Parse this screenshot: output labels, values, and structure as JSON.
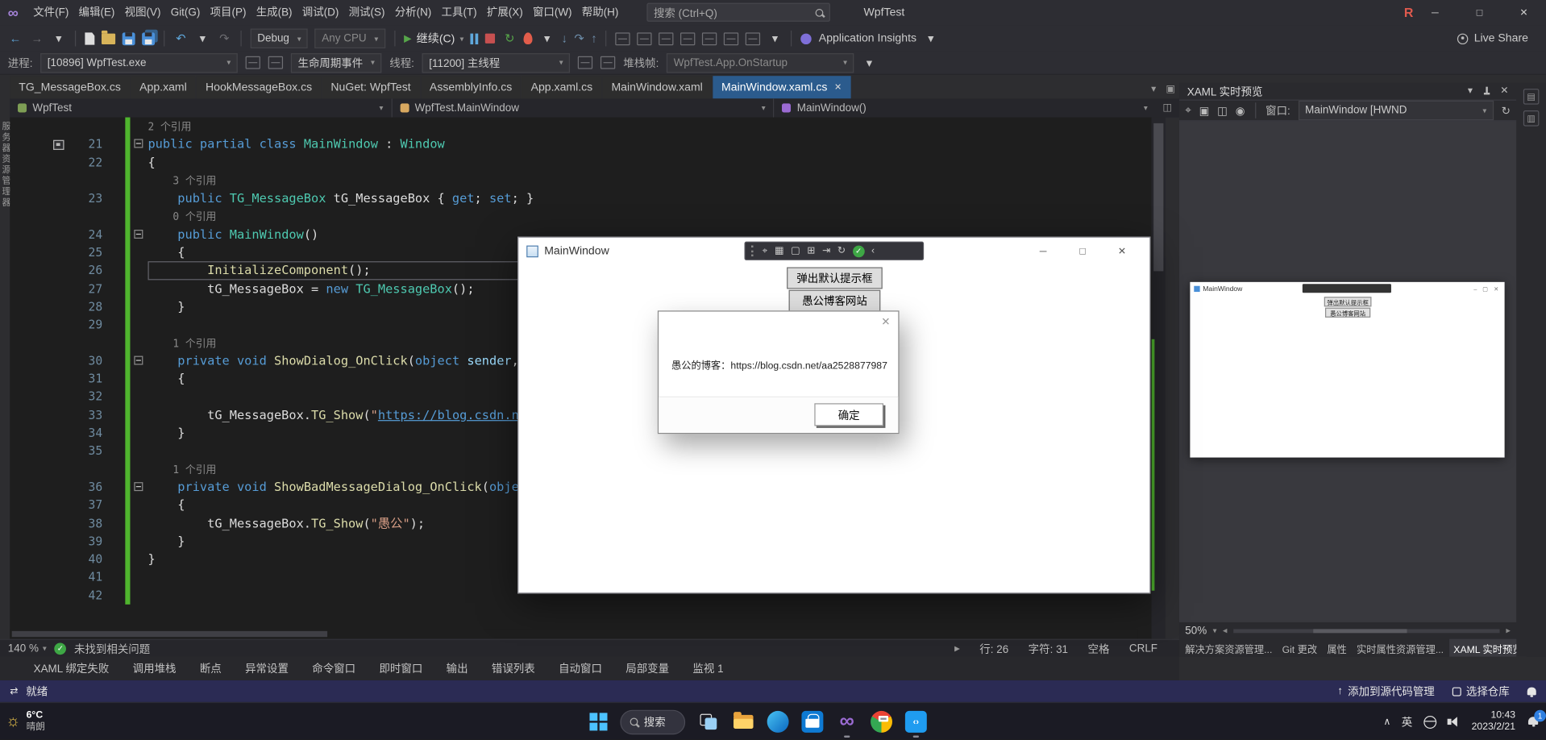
{
  "window": {
    "title": "WpfTest"
  },
  "menubar": {
    "items": [
      "文件(F)",
      "编辑(E)",
      "视图(V)",
      "Git(G)",
      "项目(P)",
      "生成(B)",
      "调试(D)",
      "测试(S)",
      "分析(N)",
      "工具(T)",
      "扩展(X)",
      "窗口(W)",
      "帮助(H)"
    ],
    "search_placeholder": "搜索 (Ctrl+Q)",
    "r_badge": "R"
  },
  "toolbar": {
    "config": "Debug",
    "platform": "Any CPU",
    "continue_label": "继续(C)",
    "app_insights": "Application Insights",
    "live_share": "Live Share"
  },
  "debugbar": {
    "process_label": "进程:",
    "process_value": "[10896] WpfTest.exe",
    "lifecycle_label": "生命周期事件",
    "thread_label": "线程:",
    "thread_value": "[11200] 主线程",
    "frame_label": "堆栈帧:",
    "frame_value": "WpfTest.App.OnStartup"
  },
  "tabs": {
    "items": [
      {
        "label": "TG_MessageBox.cs"
      },
      {
        "label": "App.xaml"
      },
      {
        "label": "HookMessageBox.cs"
      },
      {
        "label": "NuGet: WpfTest"
      },
      {
        "label": "AssemblyInfo.cs"
      },
      {
        "label": "App.xaml.cs"
      },
      {
        "label": "MainWindow.xaml"
      },
      {
        "label": "MainWindow.xaml.cs",
        "active": true
      }
    ]
  },
  "breadcrumb": {
    "project": "WpfTest",
    "type": "WpfTest.MainWindow",
    "member": "MainWindow()"
  },
  "left_rail": {
    "label": "服务器资源管理器"
  },
  "editor": {
    "zoom": "140 %",
    "health": "未找到相关问题",
    "line_label": "行: 26",
    "col_label": "字符: 31",
    "space_label": "空格",
    "eol_label": "CRLF",
    "rows": [
      {
        "n": "",
        "toks": [
          [
            "x",
            "2 个引用"
          ]
        ]
      },
      {
        "n": "21",
        "fold": true,
        "toks": [
          [
            "k",
            "public"
          ],
          [
            "p",
            " "
          ],
          [
            "k",
            "partial"
          ],
          [
            "p",
            " "
          ],
          [
            "k",
            "class"
          ],
          [
            "p",
            " "
          ],
          [
            "t",
            "MainWindow"
          ],
          [
            "p",
            " : "
          ],
          [
            "t",
            "Window"
          ]
        ]
      },
      {
        "n": "22",
        "toks": [
          [
            "p",
            "{"
          ]
        ]
      },
      {
        "n": "",
        "toks": [
          [
            "x",
            "    3 个引用"
          ]
        ]
      },
      {
        "n": "23",
        "toks": [
          [
            "p",
            "    "
          ],
          [
            "k",
            "public"
          ],
          [
            "p",
            " "
          ],
          [
            "t",
            "TG_MessageBox"
          ],
          [
            "p",
            " tG_MessageBox { "
          ],
          [
            "k",
            "get"
          ],
          [
            "p",
            "; "
          ],
          [
            "k",
            "set"
          ],
          [
            "p",
            "; }"
          ]
        ]
      },
      {
        "n": "",
        "toks": [
          [
            "x",
            "    0 个引用"
          ]
        ]
      },
      {
        "n": "24",
        "fold": true,
        "toks": [
          [
            "p",
            "    "
          ],
          [
            "k",
            "public"
          ],
          [
            "p",
            " "
          ],
          [
            "t",
            "MainWindow"
          ],
          [
            "p",
            "()"
          ]
        ]
      },
      {
        "n": "25",
        "toks": [
          [
            "p",
            "    {"
          ]
        ]
      },
      {
        "n": "26",
        "box": true,
        "toks": [
          [
            "p",
            "        "
          ],
          [
            "m",
            "InitializeComponent"
          ],
          [
            "p",
            "();"
          ]
        ]
      },
      {
        "n": "27",
        "toks": [
          [
            "p",
            "        tG_MessageBox = "
          ],
          [
            "k",
            "new"
          ],
          [
            "p",
            " "
          ],
          [
            "t",
            "TG_MessageBox"
          ],
          [
            "p",
            "();"
          ]
        ]
      },
      {
        "n": "28",
        "toks": [
          [
            "p",
            "    }"
          ]
        ]
      },
      {
        "n": "29",
        "toks": []
      },
      {
        "n": "",
        "toks": [
          [
            "x",
            "    1 个引用"
          ]
        ]
      },
      {
        "n": "30",
        "fold": true,
        "toks": [
          [
            "p",
            "    "
          ],
          [
            "k",
            "private"
          ],
          [
            "p",
            " "
          ],
          [
            "k",
            "void"
          ],
          [
            "p",
            " "
          ],
          [
            "m",
            "ShowDialog_OnClick"
          ],
          [
            "p",
            "("
          ],
          [
            "k",
            "object"
          ],
          [
            "p",
            " "
          ],
          [
            "u",
            "sender"
          ],
          [
            "p",
            ","
          ]
        ]
      },
      {
        "n": "31",
        "toks": [
          [
            "p",
            "    {"
          ]
        ]
      },
      {
        "n": "32",
        "toks": []
      },
      {
        "n": "33",
        "toks": [
          [
            "p",
            "        tG_MessageBox."
          ],
          [
            "m",
            "TG_Show"
          ],
          [
            "p",
            "("
          ],
          [
            "s",
            "\""
          ],
          [
            "l",
            "https://blog.csdn.ne"
          ]
        ]
      },
      {
        "n": "34",
        "toks": [
          [
            "p",
            "    }"
          ]
        ]
      },
      {
        "n": "35",
        "toks": []
      },
      {
        "n": "",
        "toks": [
          [
            "x",
            "    1 个引用"
          ]
        ]
      },
      {
        "n": "36",
        "fold": true,
        "toks": [
          [
            "p",
            "    "
          ],
          [
            "k",
            "private"
          ],
          [
            "p",
            " "
          ],
          [
            "k",
            "void"
          ],
          [
            "p",
            " "
          ],
          [
            "m",
            "ShowBadMessageDialog_OnClick"
          ],
          [
            "p",
            "("
          ],
          [
            "k",
            "objec"
          ]
        ]
      },
      {
        "n": "37",
        "toks": [
          [
            "p",
            "    {"
          ]
        ]
      },
      {
        "n": "38",
        "toks": [
          [
            "p",
            "        tG_MessageBox."
          ],
          [
            "m",
            "TG_Show"
          ],
          [
            "p",
            "("
          ],
          [
            "s",
            "\"愚公\""
          ],
          [
            "p",
            ");"
          ]
        ]
      },
      {
        "n": "39",
        "toks": [
          [
            "p",
            "    }"
          ]
        ]
      },
      {
        "n": "40",
        "toks": [
          [
            "p",
            "}"
          ]
        ]
      },
      {
        "n": "41",
        "toks": []
      },
      {
        "n": "42",
        "toks": []
      }
    ]
  },
  "app_window": {
    "title": "MainWindow",
    "buttons": [
      "弹出默认提示框",
      "愚公博客网站"
    ]
  },
  "dialog": {
    "message": "愚公的博客：https://blog.csdn.net/aa2528877987",
    "ok_label": "确定"
  },
  "xaml_preview": {
    "title": "XAML 实时预览",
    "window_label": "窗口:",
    "window_value": "MainWindow [HWND",
    "zoom": "50%",
    "tabs": [
      {
        "label": "解决方案资源管理..."
      },
      {
        "label": "Git 更改"
      },
      {
        "label": "属性"
      },
      {
        "label": "实时属性资源管理..."
      },
      {
        "label": "XAML 实时预览",
        "active": true
      }
    ],
    "preview": {
      "title": "MainWindow",
      "buttons": [
        "弹出默认提示框",
        "愚公博客网站"
      ]
    }
  },
  "bottom_tabs": {
    "items": [
      "XAML 绑定失败",
      "调用堆栈",
      "断点",
      "异常设置",
      "命令窗口",
      "即时窗口",
      "输出",
      "错误列表",
      "自动窗口",
      "局部变量",
      "监视 1"
    ]
  },
  "statusbar": {
    "ready": "就绪",
    "add_scc": "添加到源代码管理",
    "repo": "选择仓库"
  },
  "taskbar": {
    "temp": "6°C",
    "weather": "晴朗",
    "search": "搜索",
    "ime": "英",
    "time": "10:43",
    "date": "2023/2/21",
    "badge": "1"
  }
}
